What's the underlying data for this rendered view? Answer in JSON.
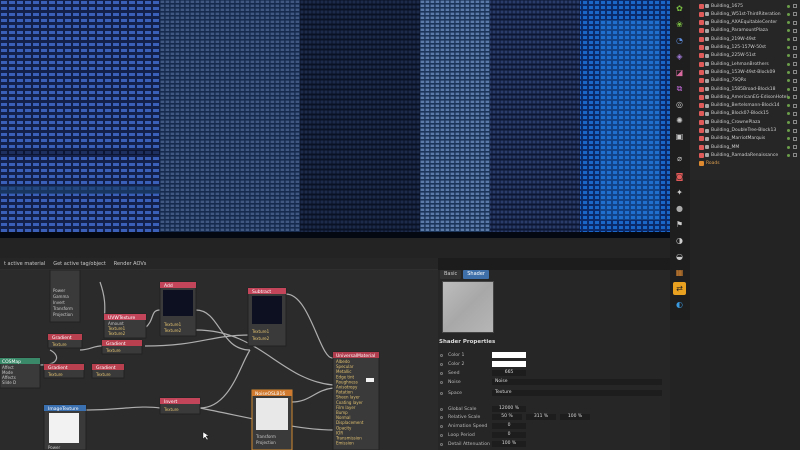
{
  "toolbar": {
    "assign_label": "t active material",
    "get_label": "Get active tag/object",
    "render_label": "Render AOVs"
  },
  "nodes": {
    "top_node_ports": [
      "Power",
      "Gamma",
      "Invert",
      "Transform",
      "Projection"
    ],
    "add": {
      "title": "Add",
      "ports": [
        "Texture1",
        "Texture2"
      ]
    },
    "subtract": {
      "title": "Subtract",
      "ports": [
        "Texture1",
        "Texture2"
      ]
    },
    "uvw": {
      "title": "UVWTexture",
      "ports": [
        "Amount",
        "Texture1",
        "Texture2"
      ]
    },
    "gradient1": {
      "title": "Gradient",
      "ports": [
        "Texture"
      ]
    },
    "gradient2": {
      "title": "Gradient",
      "ports": [
        "Texture"
      ]
    },
    "gradient3": {
      "title": "Gradient",
      "ports": [
        "Texture"
      ]
    },
    "gradient4": {
      "title": "Gradient",
      "ports": [
        "Texture"
      ]
    },
    "left_node": {
      "title": "COSMap",
      "ports": [
        "Affect",
        "Mode",
        "Affects",
        "Slide D"
      ]
    },
    "image": {
      "title": "ImageTexture",
      "ports": [
        "Power"
      ]
    },
    "invert": {
      "title": "Invert",
      "ports": [
        "Texture"
      ]
    },
    "noise": {
      "title": "NoiseOSLB16",
      "ports": [
        "Transform",
        "Projection"
      ]
    },
    "material": {
      "title": "UniversalMaterial",
      "ports": [
        "Albedo",
        "Specular",
        "Metallic",
        "Edge tint",
        "Roughness",
        "Anisotropy",
        "Rotation",
        "Sheen layer",
        "Coating layer",
        "Film layer",
        "Bump",
        "Normal",
        "Displacement",
        "Opacity",
        "IOR",
        "Transmission",
        "Emission"
      ]
    }
  },
  "props": {
    "tabs": [
      "Basic",
      "Shader"
    ],
    "active_tab": "Shader",
    "section_title": "Shader Properties",
    "rows": [
      {
        "label": "Color 1",
        "type": "color"
      },
      {
        "label": "Color 2",
        "type": "color"
      },
      {
        "label": "Seed",
        "value": "665"
      },
      {
        "label": "Noise",
        "value": "Noise"
      },
      {
        "label": "Space",
        "value": "Texture"
      },
      {
        "label": "Global Scale",
        "value": "12000 %"
      },
      {
        "label": "Relative Scale",
        "value": "50 %",
        "value2": "311 %",
        "value3": "100 %"
      },
      {
        "label": "Animation Speed",
        "value": "0"
      },
      {
        "label": "Loop Period",
        "value": "0"
      },
      {
        "label": "Detail Attenuation",
        "value": "100 %"
      }
    ]
  },
  "outliner": {
    "items": [
      "Building_1675",
      "Building_W51st-ThirdRiteration",
      "Building_AXAEquitableCenter",
      "Building_ParamountPlaza",
      "Building_219W-49st",
      "Building_125-157W-50st",
      "Building_225W-51st",
      "Building_LehmanBrothers",
      "Building_153W-49st-Block09",
      "Building_7SQRs",
      "Building_1585Broad-Block18",
      "Building_AmericanEG-EdisonHotel",
      "Building_Bertelsmann-Block14",
      "Building_Block07-Block15",
      "Building_CrownePlaza",
      "Building_DoubleTree-Block13",
      "Building_MarriotMarquis",
      "Building_MM",
      "Building_RamadaRenaissance",
      "Roads"
    ]
  },
  "colors": {
    "accent": "#3f6fa8",
    "node_header": "#c2455a",
    "material_header": "#b03d4e",
    "image_header": "#3a6fb0",
    "gradient_header": "#b8404f",
    "noise_header": "#d07a30",
    "wire": "#bdbdbd"
  }
}
